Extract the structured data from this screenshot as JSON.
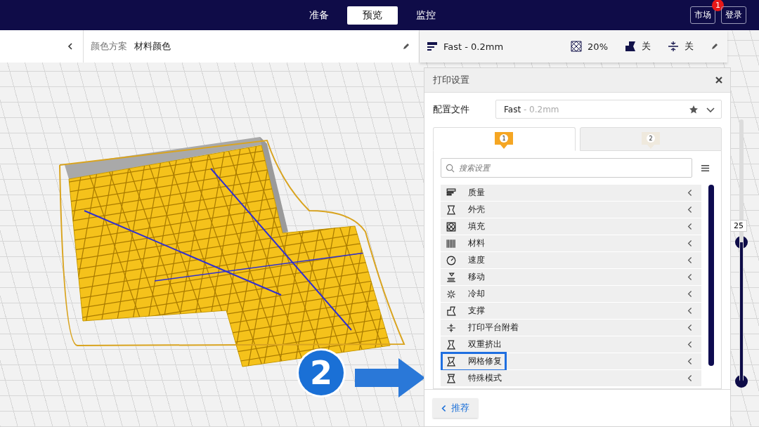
{
  "header": {
    "stages": [
      {
        "label": "准备",
        "selected": false
      },
      {
        "label": "预览",
        "selected": true
      },
      {
        "label": "监控",
        "selected": false
      }
    ],
    "buttons": [
      {
        "label": "市场",
        "badge": "1"
      },
      {
        "label": "登录"
      }
    ]
  },
  "view_bar": {
    "color_scheme_label": "颜色方案",
    "color_scheme_value": "材料颜色"
  },
  "print_summary": {
    "profile": "Fast - 0.2mm",
    "infill": "20%",
    "support": "关",
    "adhesion": "关"
  },
  "print_settings": {
    "title": "打印设置",
    "profile_label": "配置文件",
    "profile_name": "Fast",
    "profile_detail": " - 0.2mm",
    "extruder_tabs": [
      {
        "label": "1",
        "selected": true,
        "color": "#f5a623"
      },
      {
        "label": "2",
        "selected": false,
        "color": "#efe9dd"
      }
    ],
    "search": {
      "placeholder": "搜索设置"
    },
    "categories": [
      {
        "label": "质量",
        "highlighted": false
      },
      {
        "label": "外壳",
        "highlighted": false
      },
      {
        "label": "填充",
        "highlighted": false
      },
      {
        "label": "材料",
        "highlighted": false
      },
      {
        "label": "速度",
        "highlighted": false
      },
      {
        "label": "移动",
        "highlighted": false
      },
      {
        "label": "冷却",
        "highlighted": false
      },
      {
        "label": "支撑",
        "highlighted": false
      },
      {
        "label": "打印平台附着",
        "highlighted": false
      },
      {
        "label": "双重挤出",
        "highlighted": false
      },
      {
        "label": "网格修复",
        "highlighted": true
      },
      {
        "label": "特殊模式",
        "highlighted": false
      }
    ],
    "recommended_button": "推荐"
  },
  "annotation": {
    "step": "2"
  },
  "layer_slider": {
    "value": "25",
    "level": 0.53
  }
}
